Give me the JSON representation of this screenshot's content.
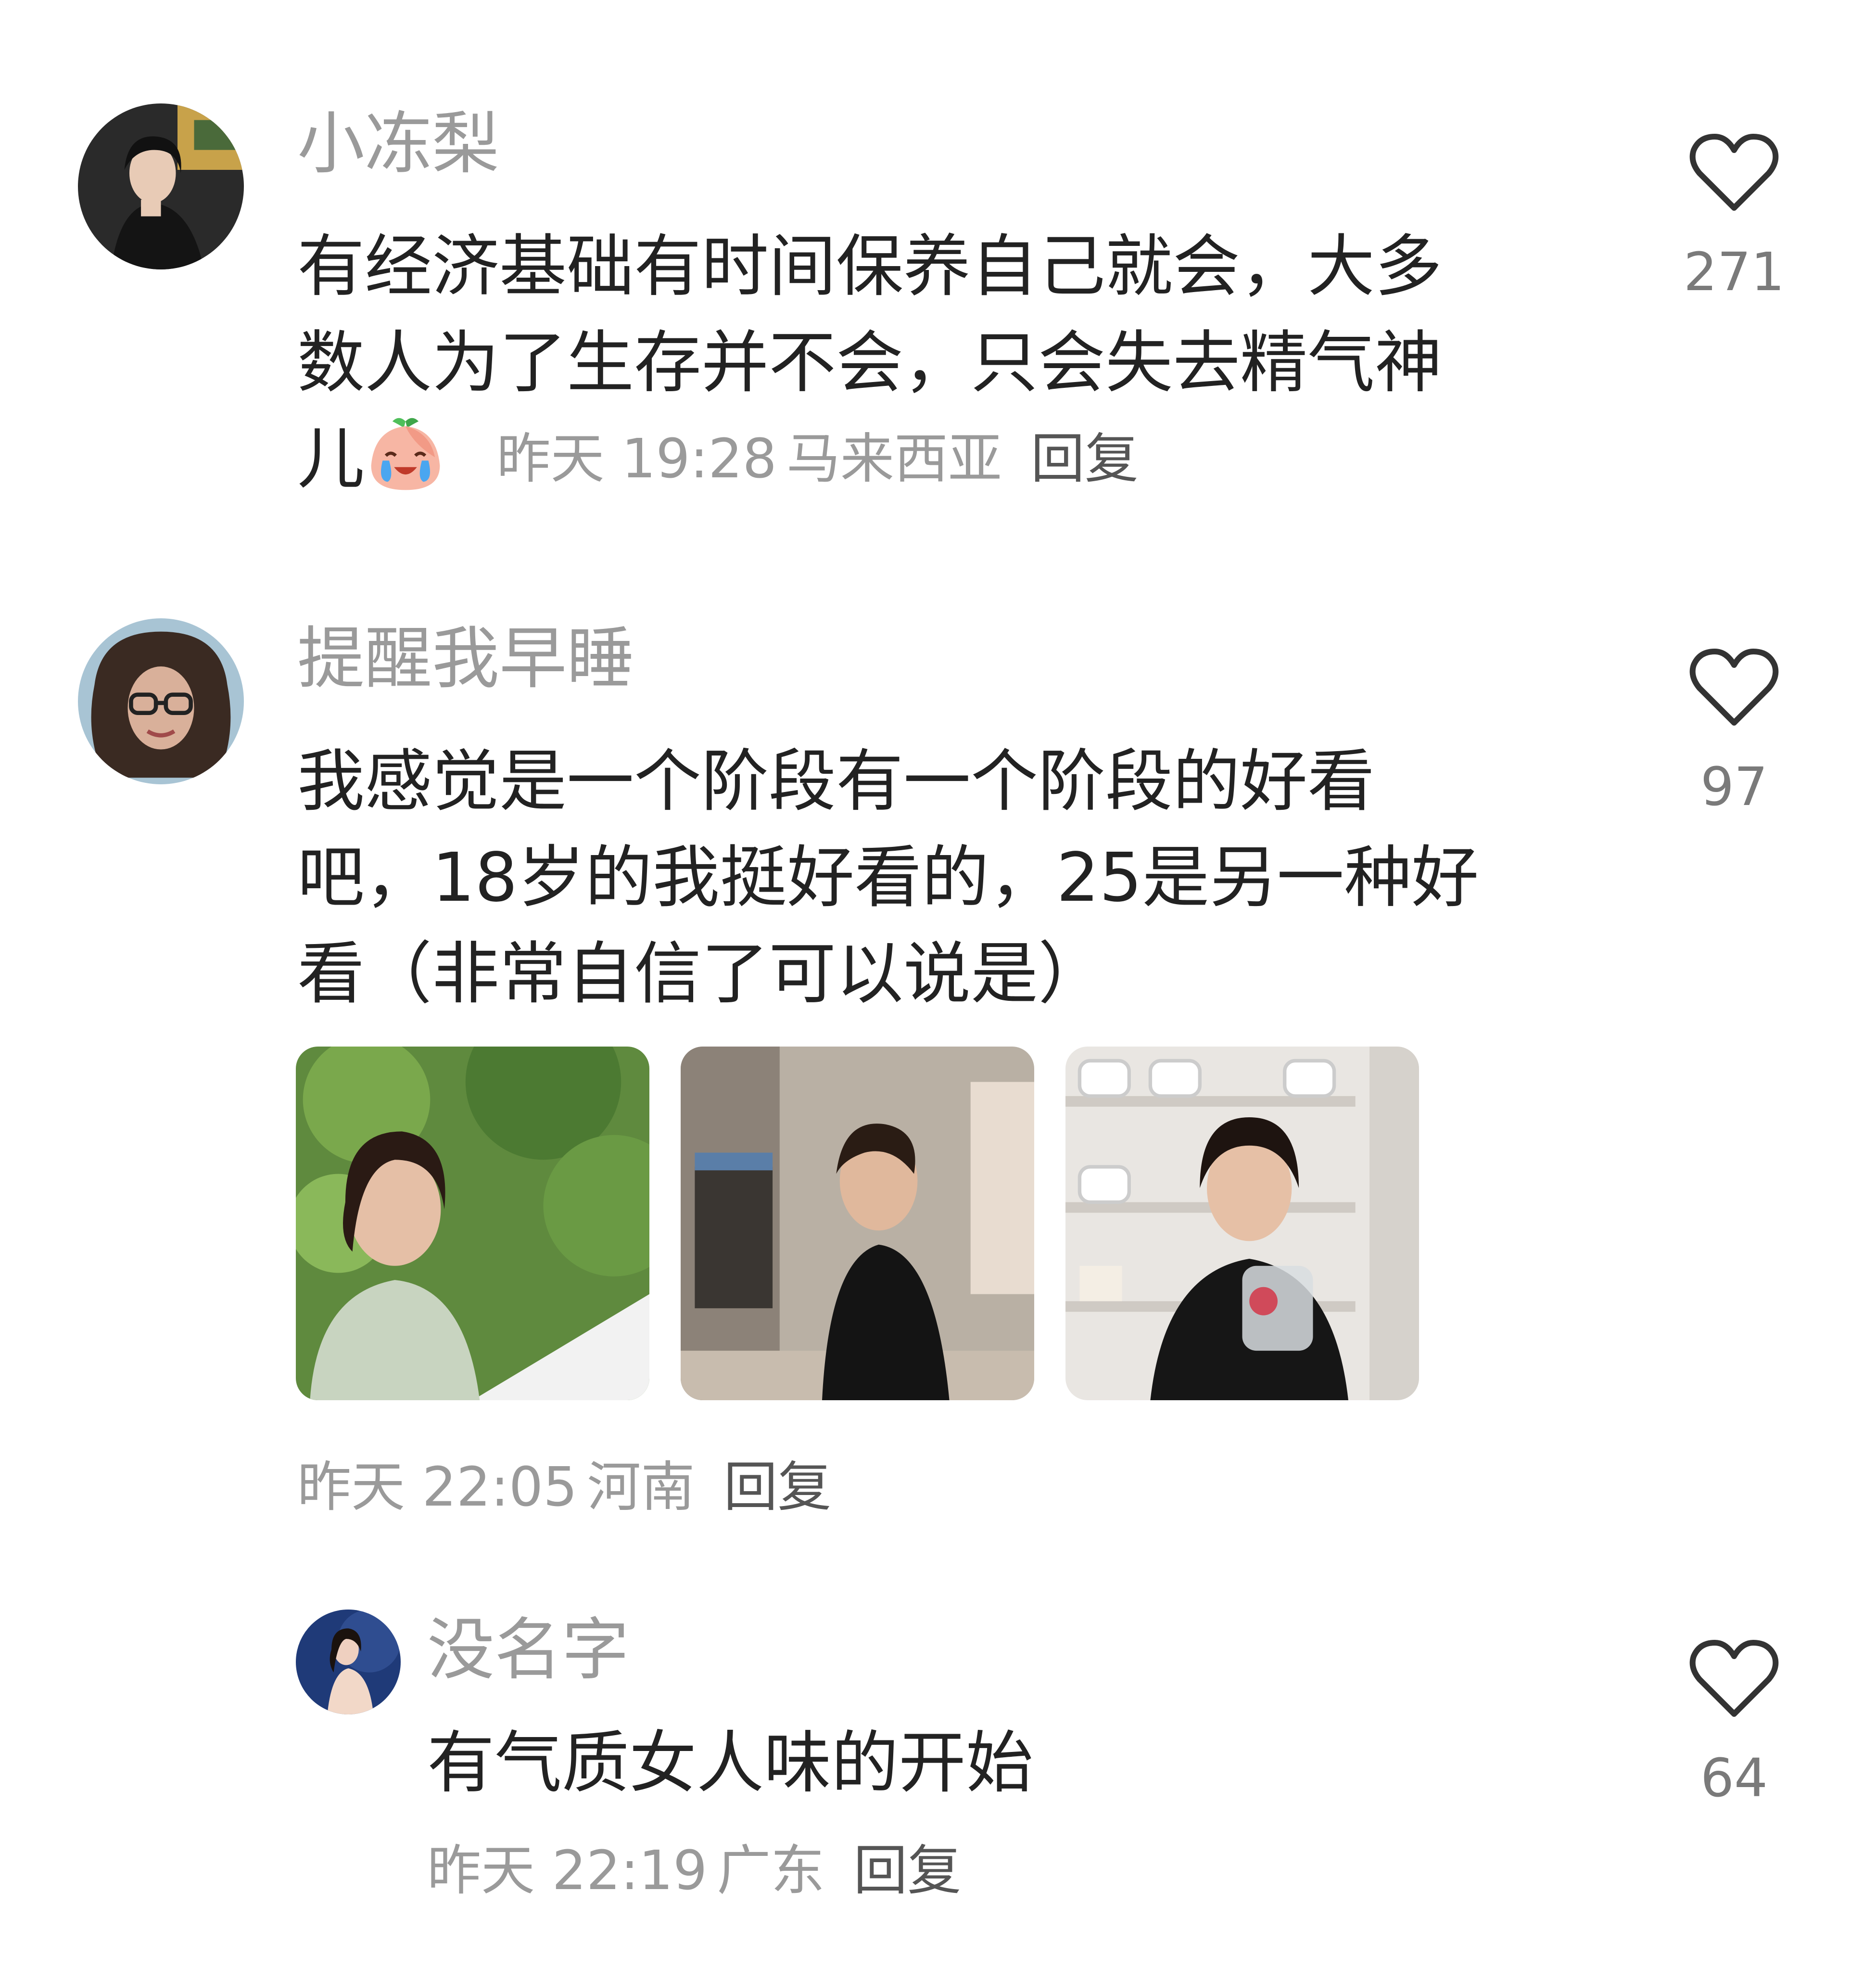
{
  "comments": [
    {
      "username": "小冻梨",
      "text_lines": [
        "有经济基础有时间保养自己就会，大多",
        "数人为了生存并不会，只会失去精气神",
        "儿"
      ],
      "emoji": "crying-peach-emoji",
      "time": "昨天 19:28",
      "location": "马来西亚",
      "reply_label": "回复",
      "likes": "271"
    },
    {
      "username": "提醒我早睡",
      "text_lines": [
        "我感觉是一个阶段有一个阶段的好看",
        "吧，18岁的我挺好看的，25是另一种好",
        "看（非常自信了可以说是）"
      ],
      "photos": [
        "photo-greenery",
        "photo-clothing-store",
        "photo-cup-shop"
      ],
      "time": "昨天 22:05",
      "location": "河南",
      "reply_label": "回复",
      "likes": "97"
    }
  ],
  "reply": {
    "username": "没名字",
    "text": "有气质女人味的开始",
    "time": "昨天 22:19",
    "location": "广东",
    "reply_label": "回复",
    "likes": "64"
  },
  "colors": {
    "username": "#9a9a9a",
    "body": "#222222",
    "meta": "#9a9a9a",
    "reply": "#555555",
    "like_count": "#7a7a7a",
    "heart_stroke": "#333333"
  }
}
